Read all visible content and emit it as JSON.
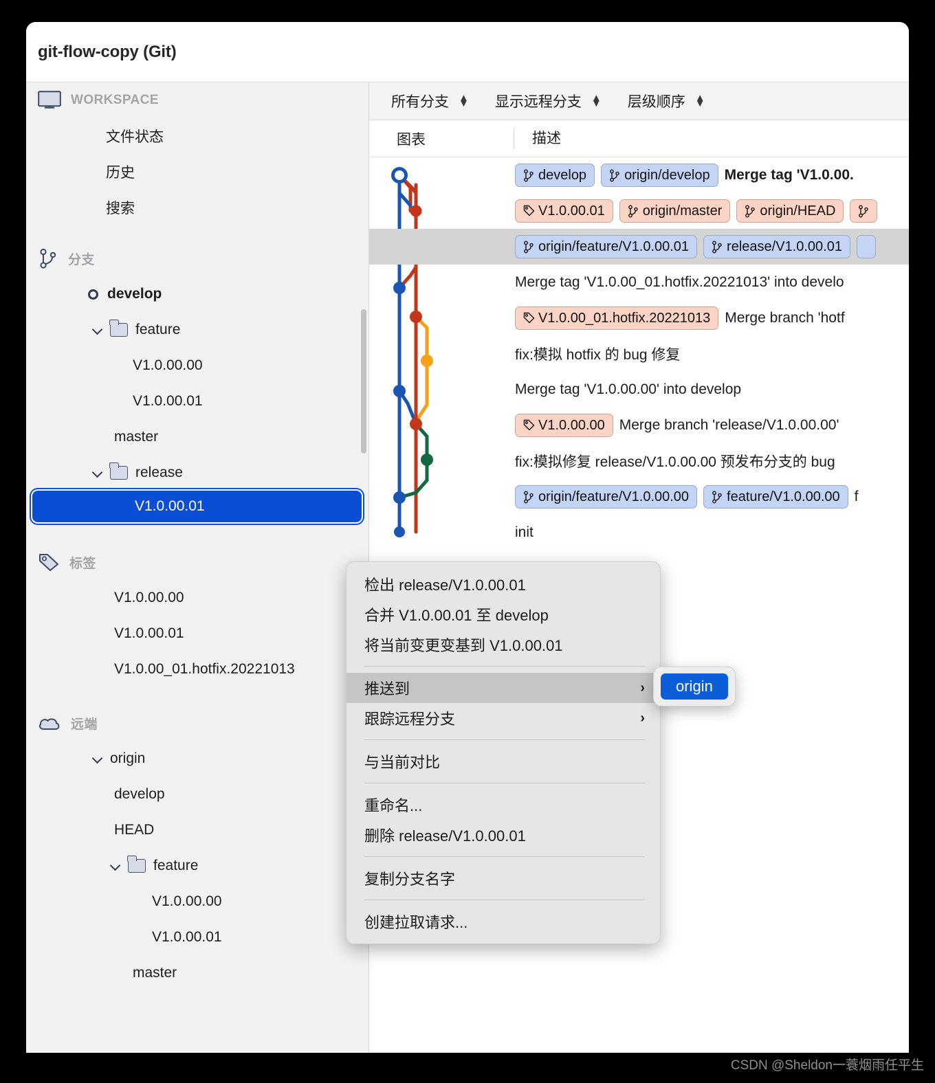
{
  "window": {
    "title": "git-flow-copy (Git)"
  },
  "sidebar": {
    "sections": [
      {
        "icon": "monitor-icon",
        "label": "WORKSPACE"
      },
      {
        "icon": "branch-icon",
        "label": "分支"
      },
      {
        "icon": "tag-icon",
        "label": "标签"
      },
      {
        "icon": "cloud-icon",
        "label": "远端"
      }
    ],
    "workspace_items": [
      "文件状态",
      "历史",
      "搜索"
    ],
    "branch_items": [
      {
        "label": "develop",
        "type": "current-branch",
        "indent": 1
      },
      {
        "label": "feature",
        "type": "folder",
        "indent": 1
      },
      {
        "label": "V1.0.00.00",
        "type": "branch",
        "indent": 2
      },
      {
        "label": "V1.0.00.01",
        "type": "branch",
        "indent": 2
      },
      {
        "label": "master",
        "type": "branch",
        "indent": 1
      },
      {
        "label": "release",
        "type": "folder",
        "indent": 1
      },
      {
        "label": "V1.0.00.01",
        "type": "branch",
        "indent": 2,
        "selected": true
      }
    ],
    "tag_items": [
      "V1.0.00.00",
      "V1.0.00.01",
      "V1.0.00_01.hotfix.20221013"
    ],
    "remote_items": [
      {
        "label": "origin",
        "type": "remote",
        "indent": 1
      },
      {
        "label": "develop",
        "type": "branch",
        "indent": 2
      },
      {
        "label": "HEAD",
        "type": "branch",
        "indent": 2
      },
      {
        "label": "feature",
        "type": "folder",
        "indent": 2
      },
      {
        "label": "V1.0.00.00",
        "type": "branch",
        "indent": 3
      },
      {
        "label": "V1.0.00.01",
        "type": "branch",
        "indent": 3
      },
      {
        "label": "master",
        "type": "branch",
        "indent": 2
      }
    ]
  },
  "toolbar": {
    "filters": [
      {
        "label": "所有分支"
      },
      {
        "label": "显示远程分支"
      },
      {
        "label": "层级顺序"
      }
    ]
  },
  "columns": {
    "graph": "图表",
    "description": "描述"
  },
  "commits": [
    {
      "selected": false,
      "chips": [
        {
          "text": "develop",
          "kind": "branch"
        },
        {
          "text": "origin/develop",
          "kind": "branch"
        }
      ],
      "message": "Merge tag 'V1.0.00.",
      "bold": true
    },
    {
      "selected": false,
      "chips": [
        {
          "text": "V1.0.00.01",
          "kind": "tag"
        },
        {
          "text": "origin/master",
          "kind": "tag"
        },
        {
          "text": "origin/HEAD",
          "kind": "tag"
        },
        {
          "text": "",
          "kind": "tag"
        }
      ],
      "message": "",
      "bold": false
    },
    {
      "selected": true,
      "chips": [
        {
          "text": "origin/feature/V1.0.00.01",
          "kind": "branch"
        },
        {
          "text": "release/V1.0.00.01",
          "kind": "branch"
        },
        {
          "text": "",
          "kind": "branch"
        }
      ],
      "message": "",
      "bold": false
    },
    {
      "selected": false,
      "chips": [],
      "message": "Merge tag 'V1.0.00_01.hotfix.20221013' into develo",
      "bold": false
    },
    {
      "selected": false,
      "chips": [
        {
          "text": "V1.0.00_01.hotfix.20221013",
          "kind": "tag"
        }
      ],
      "message": "Merge branch 'hotf",
      "bold": false
    },
    {
      "selected": false,
      "chips": [],
      "message": "fix:模拟 hotfix 的 bug 修复",
      "bold": false
    },
    {
      "selected": false,
      "chips": [],
      "message": "Merge tag 'V1.0.00.00' into develop",
      "bold": false
    },
    {
      "selected": false,
      "chips": [
        {
          "text": "V1.0.00.00",
          "kind": "tag"
        }
      ],
      "message": "Merge branch 'release/V1.0.00.00'",
      "bold": false
    },
    {
      "selected": false,
      "chips": [],
      "message": "fix:模拟修复 release/V1.0.00.00 预发布分支的 bug",
      "bold": false
    },
    {
      "selected": false,
      "chips": [
        {
          "text": "origin/feature/V1.0.00.00",
          "kind": "branch"
        },
        {
          "text": "feature/V1.0.00.00",
          "kind": "branch"
        }
      ],
      "message": "f",
      "bold": false
    },
    {
      "selected": false,
      "chips": [],
      "message": "init",
      "bold": false
    }
  ],
  "context_menu": {
    "items": [
      {
        "label": "检出 release/V1.0.00.01",
        "submenu": false,
        "highlighted": false
      },
      {
        "label": "合并 V1.0.00.01 至 develop",
        "submenu": false,
        "highlighted": false
      },
      {
        "label": "将当前变更变基到 V1.0.00.01",
        "submenu": false,
        "highlighted": false
      },
      {
        "separator": true
      },
      {
        "label": "推送到",
        "submenu": true,
        "highlighted": true,
        "arrow": "›"
      },
      {
        "label": "跟踪远程分支",
        "submenu": true,
        "highlighted": false,
        "arrow": "›"
      },
      {
        "separator": true
      },
      {
        "label": "与当前对比",
        "submenu": false,
        "highlighted": false
      },
      {
        "separator": true
      },
      {
        "label": "重命名...",
        "submenu": false,
        "highlighted": false
      },
      {
        "label": "删除 release/V1.0.00.01",
        "submenu": false,
        "highlighted": false
      },
      {
        "separator": true
      },
      {
        "label": "复制分支名字",
        "submenu": false,
        "highlighted": false
      },
      {
        "separator": true
      },
      {
        "label": "创建拉取请求...",
        "submenu": false,
        "highlighted": false
      }
    ],
    "submenu_items": [
      "origin"
    ]
  },
  "watermark": "CSDN @Sheldon一蓑烟雨任平生",
  "colors": {
    "selection_blue": "#0b4ed6",
    "branch_chip": "#c3d4f5",
    "tag_chip": "#fbd4c6",
    "graph_blue": "#1b55b4",
    "graph_red": "#c4361b",
    "graph_orange": "#f7a018",
    "graph_green": "#13683f"
  }
}
